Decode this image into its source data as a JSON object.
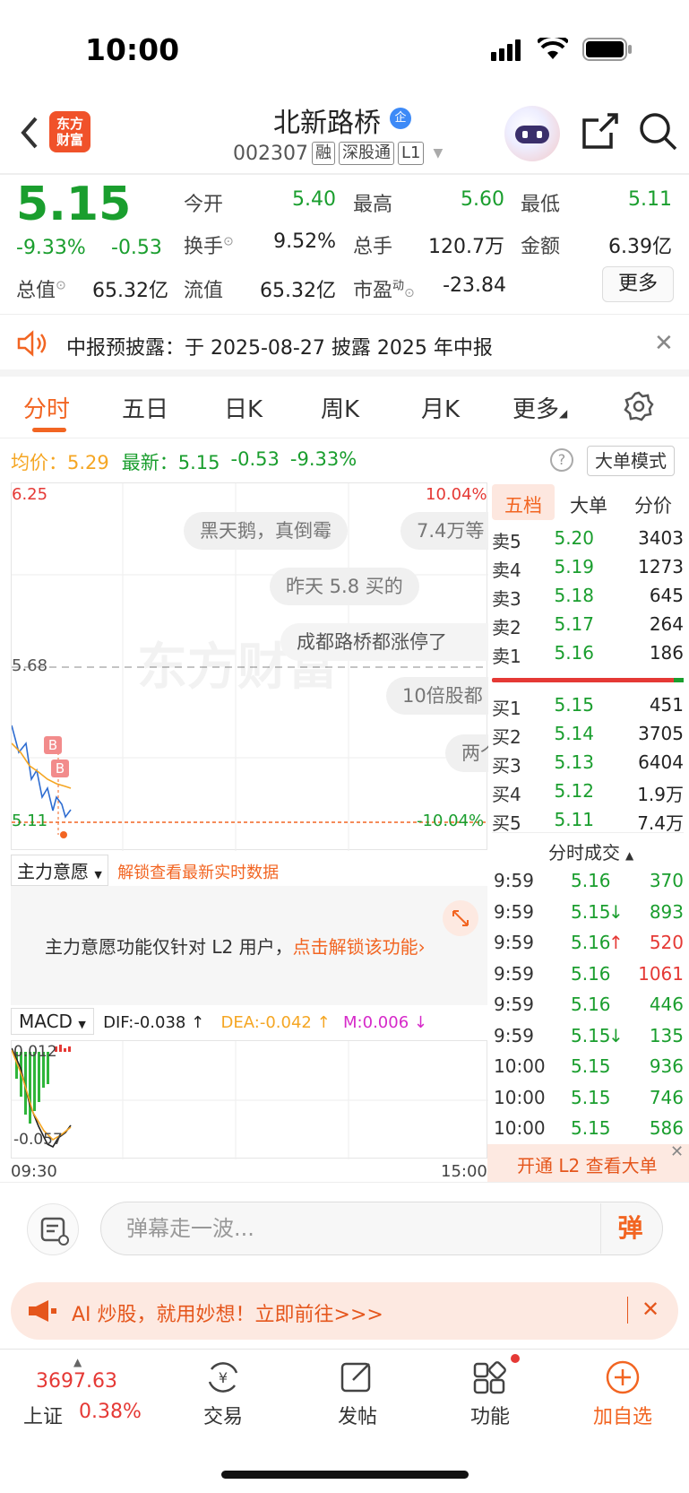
{
  "status_bar": {
    "time": "10:00"
  },
  "header": {
    "logo_text_line1": "东方",
    "logo_text_line2": "财富",
    "stock_name": "北新路桥",
    "verified_badge": "企",
    "stock_code": "002307",
    "tags": [
      "融",
      "深股通",
      "L1"
    ]
  },
  "quote": {
    "price": "5.15",
    "pct_change": "-9.33%",
    "change": "-0.53",
    "fields": {
      "open_label": "今开",
      "open": "5.40",
      "high_label": "最高",
      "high": "5.60",
      "low_label": "最低",
      "low": "5.11",
      "turnover_label": "换手",
      "turnover": "9.52%",
      "volume_label": "总手",
      "volume": "120.7万",
      "amount_label": "金额",
      "amount": "6.39亿",
      "mktcap_label": "总值",
      "mktcap": "65.32亿",
      "float_label": "流值",
      "float": "65.32亿",
      "pe_label": "市盈",
      "pe_sup": "动",
      "pe": "-23.84"
    },
    "more_button": "更多"
  },
  "notice": {
    "text": "中报预披露：于 2025-08-27 披露 2025 年中报"
  },
  "tabs": [
    "分时",
    "五日",
    "日K",
    "周K",
    "月K",
    "更多"
  ],
  "avg_row": {
    "avg_label": "均价：",
    "avg_value": "5.29",
    "latest_label": "最新：",
    "latest_value": "5.15",
    "latest_change": "-0.53",
    "latest_pct": "-9.33%",
    "big_order_button": "大单模式"
  },
  "chart": {
    "y_top": "6.25",
    "y_mid": "5.68",
    "y_bottom": "5.11",
    "pct_top": "10.04%",
    "pct_bottom": "-10.04%",
    "watermark": "东方财富",
    "buy_marker": "B",
    "danmu": [
      "黑天鹅，真倒霉",
      "7.4万等",
      "昨天 5.8 买的",
      "成都路桥都涨停了",
      "10倍股都",
      "两个"
    ]
  },
  "order_book": {
    "tabs": [
      "五档",
      "大单",
      "分价"
    ],
    "asks": [
      {
        "label": "卖5",
        "price": "5.20",
        "vol": "3403"
      },
      {
        "label": "卖4",
        "price": "5.19",
        "vol": "1273"
      },
      {
        "label": "卖3",
        "price": "5.18",
        "vol": "645"
      },
      {
        "label": "卖2",
        "price": "5.17",
        "vol": "264"
      },
      {
        "label": "卖1",
        "price": "5.16",
        "vol": "186"
      }
    ],
    "bids": [
      {
        "label": "买1",
        "price": "5.15",
        "vol": "451"
      },
      {
        "label": "买2",
        "price": "5.14",
        "vol": "3705"
      },
      {
        "label": "买3",
        "price": "5.13",
        "vol": "6404"
      },
      {
        "label": "买4",
        "price": "5.12",
        "vol": "1.9万"
      },
      {
        "label": "买5",
        "price": "5.11",
        "vol": "7.4万"
      }
    ],
    "ticks_title": "分时成交",
    "ticks": [
      {
        "time": "9:59",
        "price": "5.16",
        "arrow": "",
        "vol": "370",
        "vol_color": "green"
      },
      {
        "time": "9:59",
        "price": "5.15",
        "arrow": "↓",
        "vol": "893",
        "vol_color": "green"
      },
      {
        "time": "9:59",
        "price": "5.16",
        "arrow": "↑",
        "vol": "520",
        "vol_color": "red"
      },
      {
        "time": "9:59",
        "price": "5.16",
        "arrow": "",
        "vol": "1061",
        "vol_color": "red"
      },
      {
        "time": "9:59",
        "price": "5.16",
        "arrow": "",
        "vol": "446",
        "vol_color": "green"
      },
      {
        "time": "9:59",
        "price": "5.15",
        "arrow": "↓",
        "vol": "135",
        "vol_color": "green"
      },
      {
        "time": "10:00",
        "price": "5.15",
        "arrow": "",
        "vol": "936",
        "vol_color": "green"
      },
      {
        "time": "10:00",
        "price": "5.15",
        "arrow": "",
        "vol": "746",
        "vol_color": "green"
      },
      {
        "time": "10:00",
        "price": "5.15",
        "arrow": "",
        "vol": "586",
        "vol_color": "green"
      }
    ],
    "l2_promo": "开通 L2 查看大单"
  },
  "main_intent": {
    "label": "主力意愿",
    "unlock_text": "解锁查看最新实时数据",
    "panel_text": "主力意愿功能仅针对 L2 用户，",
    "panel_link": "点击解锁该功能"
  },
  "macd": {
    "label": "MACD",
    "dif": "DIF:-0.038 ↑",
    "dea": "DEA:-0.042 ↑",
    "m": "M:0.006 ↓",
    "y_top": "0.012",
    "y_bottom": "-0.057",
    "x_start": "09:30",
    "x_end": "15:00"
  },
  "comment_bar": {
    "placeholder": "弹幕走一波...",
    "danmu_button": "弹"
  },
  "ai_promo": {
    "text": "AI 炒股，就用妙想！立即前往>>>"
  },
  "bottom_nav": {
    "index_value": "3697.63",
    "index_name": "上证",
    "index_pct": "0.38%",
    "items": [
      "交易",
      "发帖",
      "功能",
      "加自选"
    ]
  },
  "colors": {
    "accent": "#f26522",
    "down": "#1a9e2e",
    "up": "#e53935"
  }
}
